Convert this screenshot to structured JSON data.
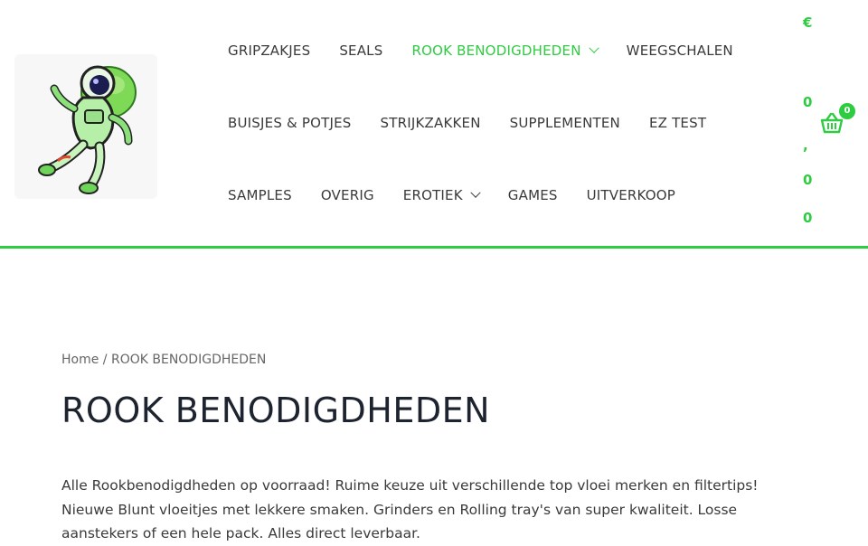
{
  "colors": {
    "accent": "#2ecc40",
    "text": "#3a3a3a",
    "heading": "#1e2330"
  },
  "logo": {
    "icon": "astronaut-logo-icon"
  },
  "nav": {
    "row1": [
      {
        "label": "GRIPZAKJES",
        "active": false,
        "dropdown": false
      },
      {
        "label": "SEALS",
        "active": false,
        "dropdown": false
      },
      {
        "label": "ROOK BENODIGDHEDEN",
        "active": true,
        "dropdown": true
      },
      {
        "label": "WEEGSCHALEN",
        "active": false,
        "dropdown": false
      }
    ],
    "row2": [
      {
        "label": "BUISJES & POTJES",
        "active": false,
        "dropdown": false
      },
      {
        "label": "STRIJKZAKKEN",
        "active": false,
        "dropdown": false
      },
      {
        "label": "SUPPLEMENTEN",
        "active": false,
        "dropdown": false
      },
      {
        "label": "EZ TEST",
        "active": false,
        "dropdown": false
      }
    ],
    "row3": [
      {
        "label": "SAMPLES",
        "active": false,
        "dropdown": false
      },
      {
        "label": "OVERIG",
        "active": false,
        "dropdown": false
      },
      {
        "label": "EROTIEK",
        "active": false,
        "dropdown": true
      },
      {
        "label": "GAMES",
        "active": false,
        "dropdown": false
      },
      {
        "label": "UITVERKOOP",
        "active": false,
        "dropdown": false
      }
    ]
  },
  "cart": {
    "price_chars": [
      "€",
      "0",
      ",",
      "0",
      "0"
    ],
    "count": "0",
    "icon": "basket-icon"
  },
  "breadcrumb": {
    "home": "Home",
    "separator": " / ",
    "current": "ROOK BENODIGDHEDEN"
  },
  "page": {
    "title": "ROOK BENODIGDHEDEN",
    "description": "Alle Rookbenodigdheden op voorraad! Ruime keuze uit verschillende top vloei merken en filtertips! Nieuwe Blunt vloeitjes met lekkere smaken. Grinders en Rolling tray's van super kwaliteit. Losse aanstekers of een hele pack. Alles direct leverbaar."
  }
}
